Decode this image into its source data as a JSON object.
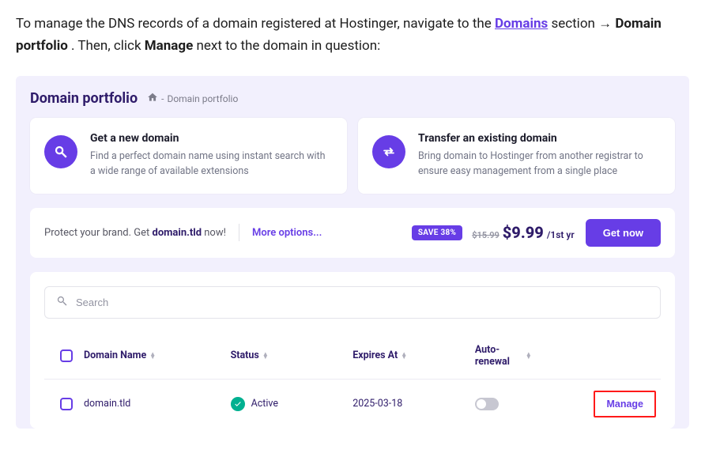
{
  "intro": {
    "pre": "To manage the DNS records of a domain registered at Hostinger, navigate to the ",
    "domains_link": "Domains",
    "post1": " section → ",
    "portfolio_bold": "Domain portfolio",
    "post2": ". Then, click ",
    "manage_bold": "Manage",
    "post3": " next to the domain in question:"
  },
  "panel": {
    "title": "Domain portfolio",
    "breadcrumb": {
      "sep": "-",
      "current": "Domain portfolio"
    }
  },
  "cards": {
    "new_domain": {
      "title": "Get a new domain",
      "desc": "Find a perfect domain name using instant search with a wide range of available extensions"
    },
    "transfer": {
      "title": "Transfer an existing domain",
      "desc": "Bring domain to Hostinger from another registrar to ensure easy management from a single place"
    }
  },
  "promo": {
    "text_pre": "Protect your brand. Get ",
    "text_bold": "domain.tld",
    "text_post": " now!",
    "more": "More options...",
    "save_badge": "SAVE 38%",
    "old_price": "$15.99",
    "new_price": "$9.99",
    "period": "/1st yr",
    "get_now": "Get now"
  },
  "list": {
    "search_placeholder": "Search",
    "columns": {
      "domain": "Domain Name",
      "status": "Status",
      "expires": "Expires At",
      "auto": "Auto-renewal"
    },
    "rows": [
      {
        "domain": "domain.tld",
        "status": "Active",
        "expires": "2025-03-18",
        "auto_renewal": false,
        "manage": "Manage"
      }
    ]
  }
}
